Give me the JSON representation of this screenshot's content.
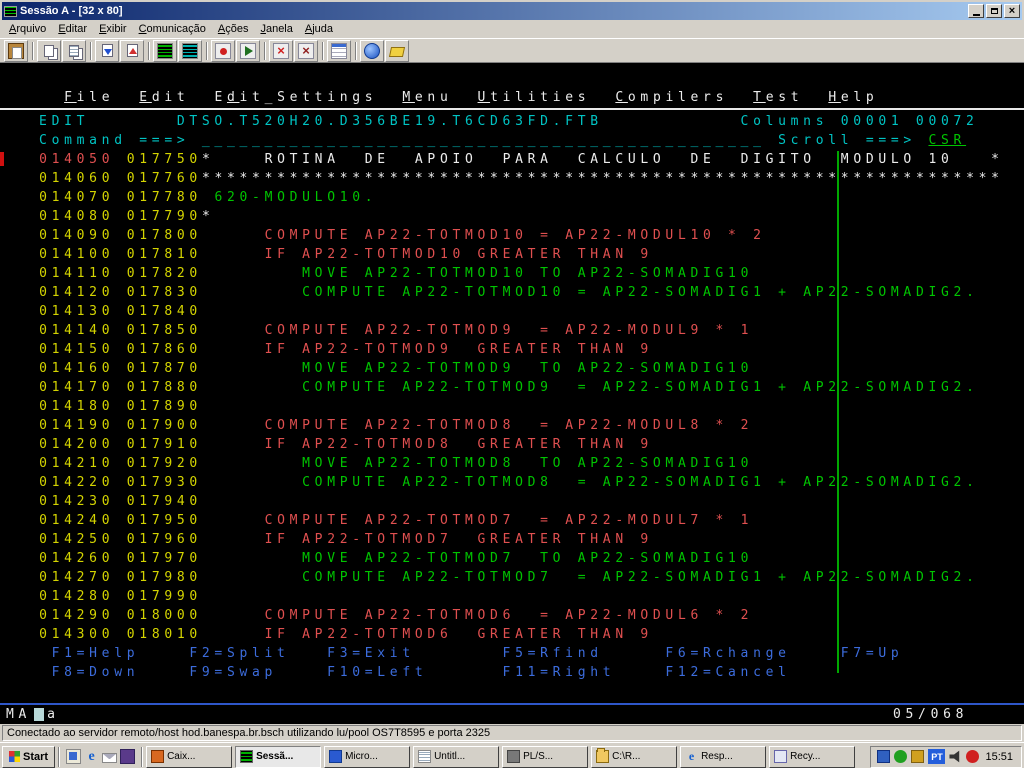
{
  "window": {
    "title": "Sessão A - [32 x 80]"
  },
  "menu": {
    "items": [
      "Arquivo",
      "Editar",
      "Exibir",
      "Comunicação",
      "Ações",
      "Janela",
      "Ajuda"
    ]
  },
  "toolbar": {
    "icons": [
      {
        "name": "paste-icon",
        "cls": "i-paste"
      },
      {
        "sep": true
      },
      {
        "name": "copy-icon",
        "cls": "i-copy"
      },
      {
        "name": "copy-append-icon",
        "cls": "i-copy2"
      },
      {
        "sep": true
      },
      {
        "name": "send-file-icon",
        "cls": "i-send"
      },
      {
        "name": "receive-file-icon",
        "cls": "i-recv"
      },
      {
        "sep": true
      },
      {
        "name": "display-setup-icon",
        "cls": "i-scr"
      },
      {
        "name": "color-setup-icon",
        "cls": "i-scr2"
      },
      {
        "sep": true
      },
      {
        "name": "record-macro-icon",
        "cls": "i-rec"
      },
      {
        "name": "play-macro-icon",
        "cls": "i-play"
      },
      {
        "sep": true
      },
      {
        "name": "stop-communication-icon",
        "cls": "i-stop"
      },
      {
        "name": "delete-icon",
        "cls": "i-del"
      },
      {
        "sep": true
      },
      {
        "name": "keypad-icon",
        "cls": "i-pad"
      },
      {
        "sep": true
      },
      {
        "name": "browser-icon",
        "cls": "i-globe"
      },
      {
        "name": "help-tag-icon",
        "cls": "i-tag"
      }
    ]
  },
  "terminal": {
    "rows": [
      {
        "s": [
          [
            " ",
            "w"
          ]
        ]
      },
      {
        "s": [
          [
            "    ",
            "w"
          ],
          [
            "F",
            "wu"
          ],
          [
            "ile  ",
            "w"
          ],
          [
            "E",
            "wu"
          ],
          [
            "dit  E",
            "w"
          ],
          [
            "d",
            "wu"
          ],
          [
            "it_Settings  ",
            "w"
          ],
          [
            "M",
            "wu"
          ],
          [
            "enu  ",
            "w"
          ],
          [
            "U",
            "wu"
          ],
          [
            "tilities  ",
            "w"
          ],
          [
            "C",
            "wu"
          ],
          [
            "ompilers  ",
            "w"
          ],
          [
            "T",
            "wu"
          ],
          [
            "est  ",
            "w"
          ],
          [
            "H",
            "wu"
          ],
          [
            "elp",
            "w"
          ]
        ]
      },
      {
        "sep": true
      },
      {
        "s": [
          [
            "  EDIT       DTSO.T520H20.D356BE19.T6CD63FD.FTB           Columns 00001 00072",
            "t"
          ]
        ]
      },
      {
        "s": [
          [
            "  Command ===> ",
            "t"
          ],
          [
            "_____________________________________________",
            "t"
          ],
          [
            " Scroll ===> ",
            "t"
          ],
          [
            "CSR",
            "gu"
          ]
        ]
      },
      {
        "s": [
          [
            "  ",
            "w"
          ],
          [
            "014050",
            "r"
          ],
          [
            " ",
            "w"
          ],
          [
            "017750",
            "y"
          ],
          [
            "*    ROTINA  DE  APOIO  PARA  CALCULO  DE  DIGITO  MODULO 10   *",
            "w"
          ]
        ]
      },
      {
        "s": [
          [
            "  ",
            "w"
          ],
          [
            "014060",
            "y"
          ],
          [
            " ",
            "w"
          ],
          [
            "017760",
            "y"
          ],
          [
            "****************************************************************",
            "w"
          ]
        ]
      },
      {
        "s": [
          [
            "  ",
            "w"
          ],
          [
            "014070",
            "y"
          ],
          [
            " ",
            "w"
          ],
          [
            "017780",
            "y"
          ],
          [
            " 620-MODULO10.",
            "g"
          ]
        ]
      },
      {
        "s": [
          [
            "  ",
            "w"
          ],
          [
            "014080",
            "y"
          ],
          [
            " ",
            "w"
          ],
          [
            "017790",
            "y"
          ],
          [
            "*",
            "w"
          ]
        ]
      },
      {
        "s": [
          [
            "  ",
            "w"
          ],
          [
            "014090",
            "y"
          ],
          [
            " ",
            "w"
          ],
          [
            "017800",
            "y"
          ],
          [
            "     COMPUTE AP22-TOTMOD10 = AP22-MODUL10 * 2",
            "r"
          ]
        ]
      },
      {
        "s": [
          [
            "  ",
            "w"
          ],
          [
            "014100",
            "y"
          ],
          [
            " ",
            "w"
          ],
          [
            "017810",
            "y"
          ],
          [
            "     IF AP22-TOTMOD10 GREATER THAN 9",
            "r"
          ]
        ]
      },
      {
        "s": [
          [
            "  ",
            "w"
          ],
          [
            "014110",
            "y"
          ],
          [
            " ",
            "w"
          ],
          [
            "017820",
            "y"
          ],
          [
            "        MOVE AP22-TOTMOD10 TO AP22-SOMADIG10",
            "g"
          ]
        ]
      },
      {
        "s": [
          [
            "  ",
            "w"
          ],
          [
            "014120",
            "y"
          ],
          [
            " ",
            "w"
          ],
          [
            "017830",
            "y"
          ],
          [
            "        COMPUTE AP22-TOTMOD10 = AP22-SOMADIG1 + AP22-SOMADIG2.",
            "g"
          ]
        ]
      },
      {
        "s": [
          [
            "  ",
            "w"
          ],
          [
            "014130",
            "y"
          ],
          [
            " ",
            "w"
          ],
          [
            "017840",
            "y"
          ]
        ]
      },
      {
        "s": [
          [
            "  ",
            "w"
          ],
          [
            "014140",
            "y"
          ],
          [
            " ",
            "w"
          ],
          [
            "017850",
            "y"
          ],
          [
            "     COMPUTE AP22-TOTMOD9  = AP22-MODUL9 * 1",
            "r"
          ]
        ]
      },
      {
        "s": [
          [
            "  ",
            "w"
          ],
          [
            "014150",
            "y"
          ],
          [
            " ",
            "w"
          ],
          [
            "017860",
            "y"
          ],
          [
            "     IF AP22-TOTMOD9  GREATER THAN 9",
            "r"
          ]
        ]
      },
      {
        "s": [
          [
            "  ",
            "w"
          ],
          [
            "014160",
            "y"
          ],
          [
            " ",
            "w"
          ],
          [
            "017870",
            "y"
          ],
          [
            "        MOVE AP22-TOTMOD9  TO AP22-SOMADIG10",
            "g"
          ]
        ]
      },
      {
        "s": [
          [
            "  ",
            "w"
          ],
          [
            "014170",
            "y"
          ],
          [
            " ",
            "w"
          ],
          [
            "017880",
            "y"
          ],
          [
            "        COMPUTE AP22-TOTMOD9  = AP22-SOMADIG1 + AP22-SOMADIG2.",
            "g"
          ]
        ]
      },
      {
        "s": [
          [
            "  ",
            "w"
          ],
          [
            "014180",
            "y"
          ],
          [
            " ",
            "w"
          ],
          [
            "017890",
            "y"
          ]
        ]
      },
      {
        "s": [
          [
            "  ",
            "w"
          ],
          [
            "014190",
            "y"
          ],
          [
            " ",
            "w"
          ],
          [
            "017900",
            "y"
          ],
          [
            "     COMPUTE AP22-TOTMOD8  = AP22-MODUL8 * 2",
            "r"
          ]
        ]
      },
      {
        "s": [
          [
            "  ",
            "w"
          ],
          [
            "014200",
            "y"
          ],
          [
            " ",
            "w"
          ],
          [
            "017910",
            "y"
          ],
          [
            "     IF AP22-TOTMOD8  GREATER THAN 9",
            "r"
          ]
        ]
      },
      {
        "s": [
          [
            "  ",
            "w"
          ],
          [
            "014210",
            "y"
          ],
          [
            " ",
            "w"
          ],
          [
            "017920",
            "y"
          ],
          [
            "        MOVE AP22-TOTMOD8  TO AP22-SOMADIG10",
            "g"
          ]
        ]
      },
      {
        "s": [
          [
            "  ",
            "w"
          ],
          [
            "014220",
            "y"
          ],
          [
            " ",
            "w"
          ],
          [
            "017930",
            "y"
          ],
          [
            "        COMPUTE AP22-TOTMOD8  = AP22-SOMADIG1 + AP22-SOMADIG2.",
            "g"
          ]
        ]
      },
      {
        "s": [
          [
            "  ",
            "w"
          ],
          [
            "014230",
            "y"
          ],
          [
            " ",
            "w"
          ],
          [
            "017940",
            "y"
          ]
        ]
      },
      {
        "s": [
          [
            "  ",
            "w"
          ],
          [
            "014240",
            "y"
          ],
          [
            " ",
            "w"
          ],
          [
            "017950",
            "y"
          ],
          [
            "     COMPUTE AP22-TOTMOD7  = AP22-MODUL7 * 1",
            "r"
          ]
        ]
      },
      {
        "s": [
          [
            "  ",
            "w"
          ],
          [
            "014250",
            "y"
          ],
          [
            " ",
            "w"
          ],
          [
            "017960",
            "y"
          ],
          [
            "     IF AP22-TOTMOD7  GREATER THAN 9",
            "r"
          ]
        ]
      },
      {
        "s": [
          [
            "  ",
            "w"
          ],
          [
            "014260",
            "y"
          ],
          [
            " ",
            "w"
          ],
          [
            "017970",
            "y"
          ],
          [
            "        MOVE AP22-TOTMOD7  TO AP22-SOMADIG10",
            "g"
          ]
        ]
      },
      {
        "s": [
          [
            "  ",
            "w"
          ],
          [
            "014270",
            "y"
          ],
          [
            " ",
            "w"
          ],
          [
            "017980",
            "y"
          ],
          [
            "        COMPUTE AP22-TOTMOD7  = AP22-SOMADIG1 + AP22-SOMADIG2.",
            "g"
          ]
        ]
      },
      {
        "s": [
          [
            "  ",
            "w"
          ],
          [
            "014280",
            "y"
          ],
          [
            " ",
            "w"
          ],
          [
            "017990",
            "y"
          ]
        ]
      },
      {
        "s": [
          [
            "  ",
            "w"
          ],
          [
            "014290",
            "y"
          ],
          [
            " ",
            "w"
          ],
          [
            "018000",
            "y"
          ],
          [
            "     COMPUTE AP22-TOTMOD6  = AP22-MODUL6 * 2",
            "r"
          ]
        ]
      },
      {
        "s": [
          [
            "  ",
            "w"
          ],
          [
            "014300",
            "y"
          ],
          [
            " ",
            "w"
          ],
          [
            "018010",
            "y"
          ],
          [
            "     IF AP22-TOTMOD6  GREATER THAN 9",
            "r"
          ]
        ]
      },
      {
        "s": [
          [
            "   F1=Help    F2=Split   F3=Exit       F5=Rfind     F6=Rchange    F7=Up",
            "b"
          ]
        ]
      },
      {
        "s": [
          [
            "   F8=Down    F9=Swap    F10=Left      F11=Right    F12=Cancel",
            "b"
          ]
        ]
      }
    ],
    "oia": {
      "status": "MA",
      "char": "a",
      "position": "05/068"
    }
  },
  "connection": {
    "text": "Conectado ao servidor remoto/host hod.banespa.br.bsch utilizando lu/pool OS7T8595 e porta 2325"
  },
  "taskbar": {
    "start_label": "Start",
    "quick_launch": [
      {
        "name": "show-desktop-icon",
        "cls": "ql-desk"
      },
      {
        "name": "internet-explorer-icon",
        "cls": "ql-ie"
      },
      {
        "name": "email-icon",
        "cls": "ql-mail"
      },
      {
        "name": "app-launcher-icon",
        "cls": "ql-app"
      }
    ],
    "buttons": [
      {
        "label": "Caix...",
        "cls": "ib-caix"
      },
      {
        "label": "Sessã...",
        "cls": "ib-sess",
        "active": true
      },
      {
        "label": "Micro...",
        "cls": "ib-micro"
      },
      {
        "label": "Untitl...",
        "cls": "ib-note"
      },
      {
        "label": "PL/S...",
        "cls": "ib-pls"
      },
      {
        "label": "C:\\R...",
        "cls": "ib-folder"
      },
      {
        "label": "Resp...",
        "cls": "ib-ie"
      },
      {
        "label": "Recy...",
        "cls": "ib-recycle"
      }
    ],
    "tray": {
      "left": [
        {
          "name": "tray-display-icon",
          "cls": "ti-disp"
        },
        {
          "name": "tray-shield-icon",
          "cls": "ti-shield"
        },
        {
          "name": "tray-mail-icon",
          "cls": "ti-msg"
        }
      ],
      "lang": "PT",
      "right": [
        {
          "name": "volume-icon",
          "cls": "ti-vol"
        },
        {
          "name": "tray-antivirus-icon",
          "cls": "ti-av"
        }
      ],
      "clock": "15:51"
    }
  }
}
